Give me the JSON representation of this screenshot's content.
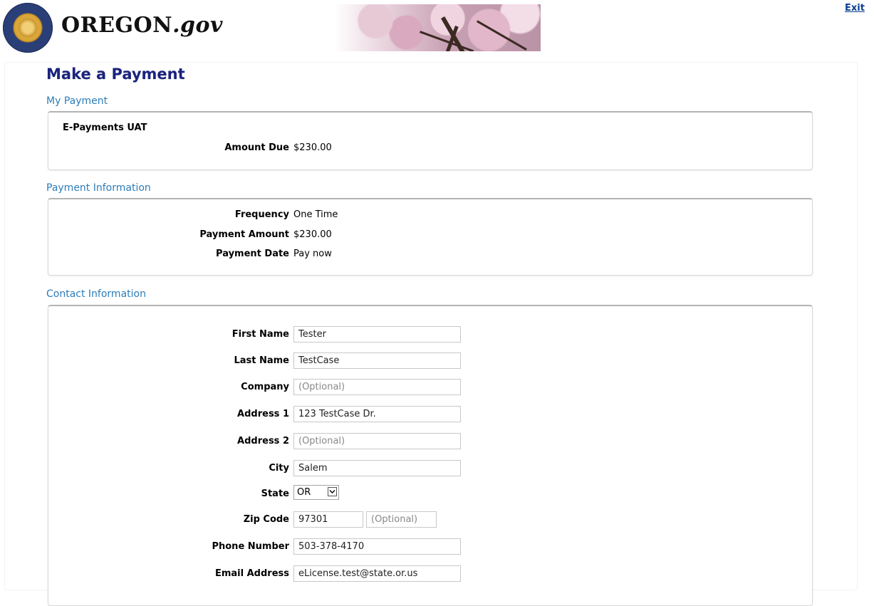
{
  "header": {
    "brand_main": "OREGON",
    "brand_suffix": ".gov",
    "exit_label": "Exit"
  },
  "page": {
    "title": "Make a Payment"
  },
  "my_payment": {
    "section_title": "My Payment",
    "service_name": "E-Payments UAT",
    "amount_due_label": "Amount Due",
    "amount_due_value": "$230.00"
  },
  "payment_info": {
    "section_title": "Payment Information",
    "rows": [
      {
        "label": "Frequency",
        "value": "One Time"
      },
      {
        "label": "Payment Amount",
        "value": "$230.00"
      },
      {
        "label": "Payment Date",
        "value": "Pay now"
      }
    ]
  },
  "contact": {
    "section_title": "Contact Information",
    "first_name": {
      "label": "First Name",
      "value": "Tester"
    },
    "last_name": {
      "label": "Last Name",
      "value": "TestCase"
    },
    "company": {
      "label": "Company",
      "placeholder": "(Optional)"
    },
    "address1": {
      "label": "Address 1",
      "value": "123 TestCase Dr."
    },
    "address2": {
      "label": "Address 2",
      "placeholder": "(Optional)"
    },
    "city": {
      "label": "City",
      "value": "Salem"
    },
    "state": {
      "label": "State",
      "value": "OR"
    },
    "zip": {
      "label": "Zip Code",
      "value": "97301",
      "ext_placeholder": "(Optional)"
    },
    "phone": {
      "label": "Phone Number",
      "value": "503-378-4170"
    },
    "email": {
      "label": "Email Address",
      "value": "eLicense.test@state.or.us"
    }
  },
  "colors": {
    "title": "#1a237e",
    "section_title": "#2c7db8",
    "link": "#0b3d91"
  }
}
